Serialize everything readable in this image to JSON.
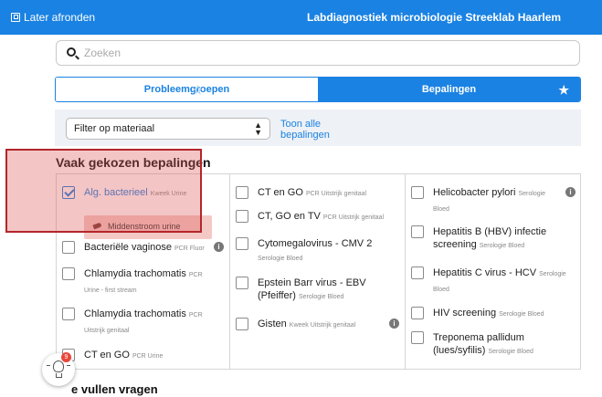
{
  "topbar": {
    "later_label": "Later afronden",
    "title": "Labdiagnostiek microbiologie Streeklab Haarlem"
  },
  "search": {
    "placeholder": "Zoeken",
    "value": ""
  },
  "tabs": [
    {
      "label": "Probleemgroepen",
      "active": false
    },
    {
      "label": "Bepalingen",
      "active": true
    }
  ],
  "filter": {
    "select_label": "Filter op materiaal",
    "show_all": "Toon alle bepalingen"
  },
  "section": {
    "title": "Vaak gekozen bepalingen"
  },
  "columns": [
    [
      {
        "name": "Alg. bacterieel",
        "tag": "Kweek Urine",
        "sub": "",
        "checked": true,
        "info": false,
        "chip": "Middenstroom urine"
      },
      {
        "name": "Bacteriële vaginose",
        "tag": "PCR Fluor",
        "sub": "",
        "checked": false,
        "info": true
      },
      {
        "name": "Chlamydia trachomatis",
        "tag": "PCR",
        "sub": "Urine - first stream",
        "checked": false,
        "info": false
      },
      {
        "name": "Chlamydia trachomatis",
        "tag": "PCR",
        "sub": "Uitstrijk genitaal",
        "checked": false,
        "info": false
      },
      {
        "name": "CT en GO",
        "tag": "PCR Urine",
        "sub": "",
        "checked": false,
        "info": false
      }
    ],
    [
      {
        "name": "CT en GO",
        "tag": "PCR Uitstrijk genitaal",
        "sub": "",
        "checked": false,
        "info": false
      },
      {
        "name": "CT, GO en TV",
        "tag": "PCR Uitstrijk genitaal",
        "sub": "",
        "checked": false,
        "info": false
      },
      {
        "name": "Cytomegalovirus - CMV 2",
        "tag": "",
        "sub": "Serologie Bloed",
        "checked": false,
        "info": false
      },
      {
        "name": "Epstein Barr virus - EBV (Pfeiffer)",
        "tag": "Serologie Bloed",
        "sub": "",
        "checked": false,
        "info": false
      },
      {
        "name": "Gisten",
        "tag": "Kweek Uitstrijk genitaal",
        "sub": "",
        "checked": false,
        "info": true
      }
    ],
    [
      {
        "name": "Helicobacter pylori",
        "tag": "Serologie",
        "sub": "Bloed",
        "checked": false,
        "info": true
      },
      {
        "name": "Hepatitis B (HBV) infectie screening",
        "tag": "Serologie Bloed",
        "sub": "",
        "checked": false,
        "info": false
      },
      {
        "name": "Hepatitis C virus - HCV",
        "tag": "Serologie",
        "sub": "Bloed",
        "checked": false,
        "info": false
      },
      {
        "name": "HIV screening",
        "tag": "Serologie Bloed",
        "sub": "",
        "checked": false,
        "info": false
      },
      {
        "name": "Treponema pallidum (lues/syfilis)",
        "tag": "Serologie Bloed",
        "sub": "",
        "checked": false,
        "info": false
      }
    ]
  ],
  "help": {
    "badge_count": "9"
  },
  "bottom": {
    "title": "Te vullen vragen",
    "visible_title": "e vullen vragen"
  },
  "colors": {
    "accent": "#1a82e2",
    "highlight": "#b3262b"
  }
}
